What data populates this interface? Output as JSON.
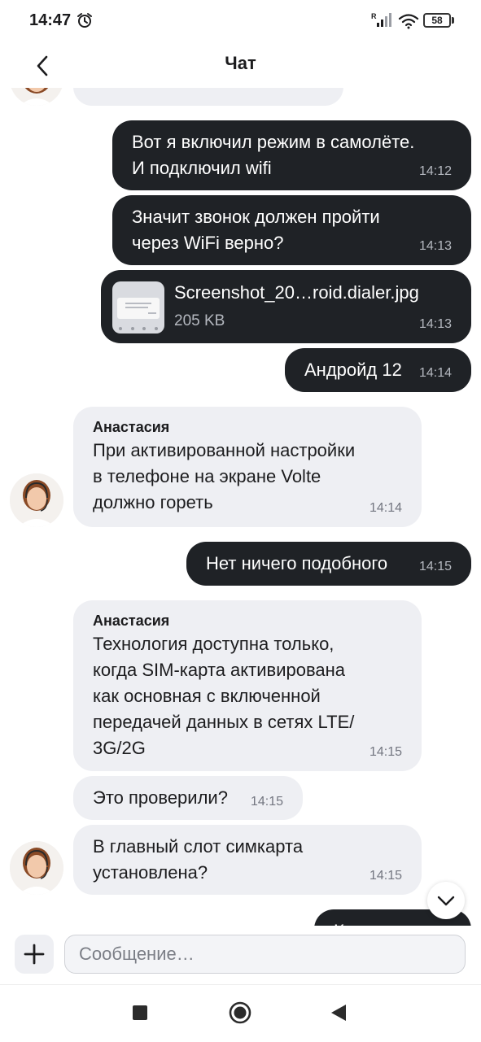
{
  "status_bar": {
    "time": "14:47",
    "battery": "58",
    "signal_badge": "R"
  },
  "header": {
    "title": "Чат"
  },
  "messages": [
    {
      "text": "Вот я включил режим в самолёте.\nИ подключил wifi",
      "time": "14:12"
    },
    {
      "text": "Значит звонок должен пройти\nчерез  WiFi верно?",
      "time": "14:13"
    },
    {
      "file_name": "Screenshot_20…roid.dialer.jpg",
      "file_size": "205 KB",
      "time": "14:13"
    },
    {
      "text": "Андройд 12",
      "time": "14:14"
    },
    {
      "sender": "Анастасия",
      "text": "При активированной настройки\nв телефоне на экране Volte\nдолжно гореть",
      "time": "14:14"
    },
    {
      "text": "Нет ничего подобного",
      "time": "14:15"
    },
    {
      "sender": "Анастасия",
      "text": "Технология доступна только,\nкогда SIM-карта активирована\nкак основная с включенной\nпередачей данных в сетях LTE/\n3G/2G",
      "time": "14:15"
    },
    {
      "text": "Это проверили?",
      "time": "14:15"
    },
    {
      "text": "В главный слот симкарта\nустановлена?",
      "time": "14:15"
    },
    {
      "text": "К…"
    }
  ],
  "composer": {
    "placeholder": "Сообщение…"
  },
  "icons": {
    "back": "chevron-left-icon",
    "alarm": "alarm-icon",
    "signal": "signal-icon",
    "wifi": "wifi-icon",
    "scroll_down": "chevron-down-icon",
    "plus": "plus-icon",
    "nav_recents": "square-icon",
    "nav_home": "circle-icon",
    "nav_back": "triangle-back-icon"
  },
  "colors": {
    "outgoing_bubble": "#1f2226",
    "incoming_bubble": "#eeeff3",
    "background": "#ffffff"
  }
}
